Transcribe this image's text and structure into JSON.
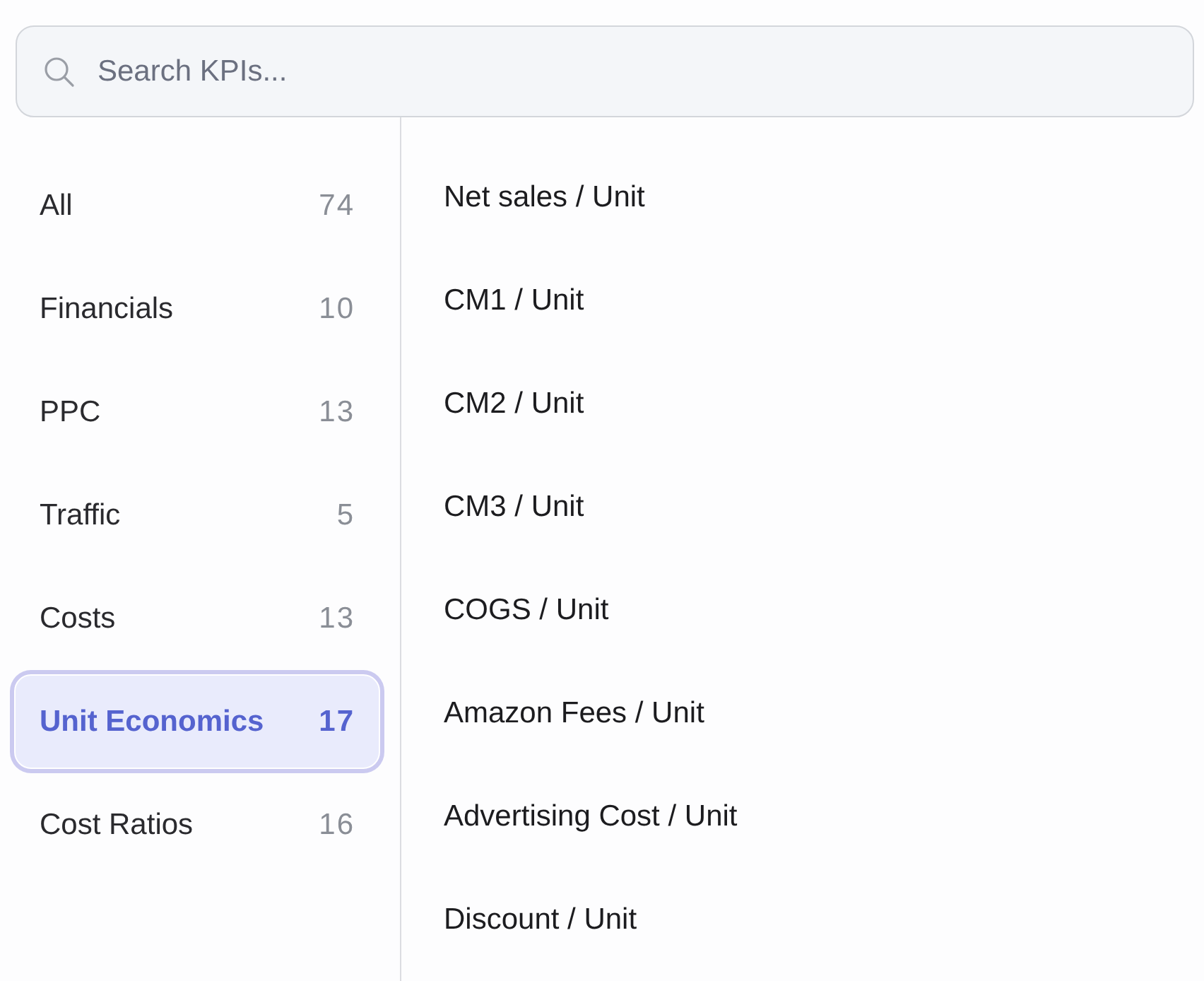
{
  "search": {
    "placeholder": "Search KPIs..."
  },
  "categories": [
    {
      "label": "All",
      "count": "74",
      "selected": false
    },
    {
      "label": "Financials",
      "count": "10",
      "selected": false
    },
    {
      "label": "PPC",
      "count": "13",
      "selected": false
    },
    {
      "label": "Traffic",
      "count": "5",
      "selected": false
    },
    {
      "label": "Costs",
      "count": "13",
      "selected": false
    },
    {
      "label": "Unit Economics",
      "count": "17",
      "selected": true
    },
    {
      "label": "Cost Ratios",
      "count": "16",
      "selected": false
    }
  ],
  "kpis": [
    "Net sales / Unit",
    "CM1 / Unit",
    "CM2 / Unit",
    "CM3 / Unit",
    "COGS / Unit",
    "Amazon Fees / Unit",
    "Advertising Cost / Unit",
    "Discount / Unit"
  ]
}
